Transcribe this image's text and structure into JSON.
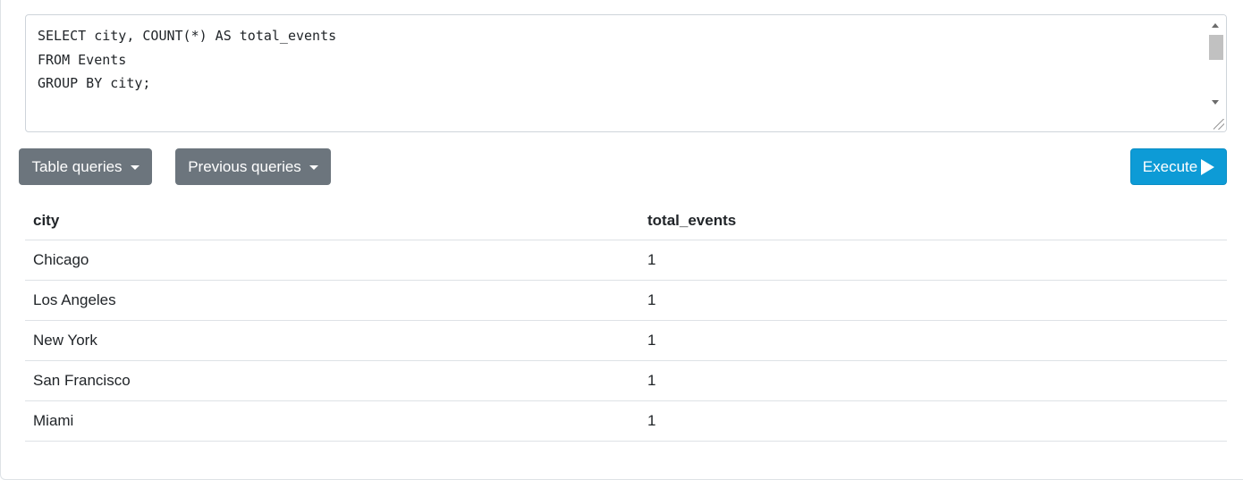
{
  "editor": {
    "lines": [
      "SELECT city, COUNT(*) AS total_events",
      "FROM Events",
      "GROUP BY city;"
    ]
  },
  "toolbar": {
    "table_queries_label": "Table queries",
    "previous_queries_label": "Previous queries",
    "execute_label": "Execute"
  },
  "results": {
    "columns": [
      "city",
      "total_events"
    ],
    "rows": [
      [
        "Chicago",
        "1"
      ],
      [
        "Los Angeles",
        "1"
      ],
      [
        "New York",
        "1"
      ],
      [
        "San Francisco",
        "1"
      ],
      [
        "Miami",
        "1"
      ]
    ]
  },
  "colors": {
    "secondary_button": "#6c757d",
    "execute_button": "#0d9bd6"
  }
}
